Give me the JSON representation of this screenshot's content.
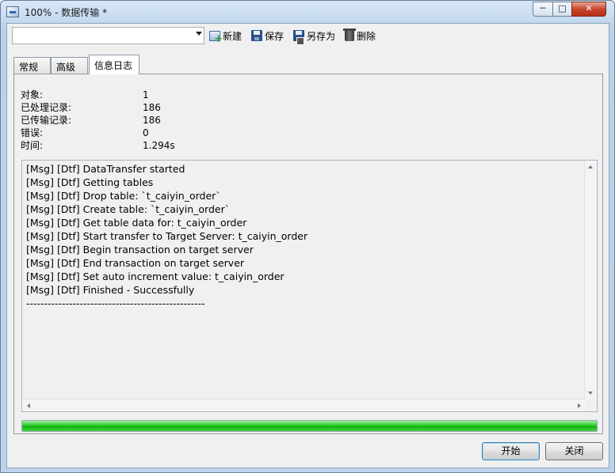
{
  "window": {
    "title": "100% - 数据传输 *",
    "controls": {
      "minimize": "─",
      "maximize": "□",
      "close": "✕"
    }
  },
  "toolbar": {
    "profile_value": "",
    "new_label": "新建",
    "save_label": "保存",
    "save_as_label": "另存为",
    "delete_label": "删除"
  },
  "tabs": [
    {
      "label": "常规",
      "active": false
    },
    {
      "label": "高级",
      "active": false
    },
    {
      "label": "信息日志",
      "active": true
    }
  ],
  "stats": [
    {
      "label": "对象:",
      "value": "1"
    },
    {
      "label": "已处理记录:",
      "value": "186"
    },
    {
      "label": "已传输记录:",
      "value": "186"
    },
    {
      "label": "错误:",
      "value": "0"
    },
    {
      "label": "时间:",
      "value": "1.294s"
    }
  ],
  "log": [
    "[Msg] [Dtf] DataTransfer started",
    "[Msg] [Dtf] Getting tables",
    "[Msg] [Dtf] Drop table: `t_caiyin_order`",
    "[Msg] [Dtf] Create table: `t_caiyin_order`",
    "[Msg] [Dtf] Get table data for: t_caiyin_order",
    "[Msg] [Dtf] Start transfer to Target Server: t_caiyin_order",
    "[Msg] [Dtf] Begin transaction on target server",
    "[Msg] [Dtf] End transaction on target server",
    "[Msg] [Dtf] Set auto increment value: t_caiyin_order",
    "[Msg] [Dtf] Finished - Successfully",
    "--------------------------------------------------"
  ],
  "progress": {
    "percent": 100,
    "color": "#22c322"
  },
  "buttons": {
    "start_label": "开始",
    "close_label": "关闭"
  }
}
